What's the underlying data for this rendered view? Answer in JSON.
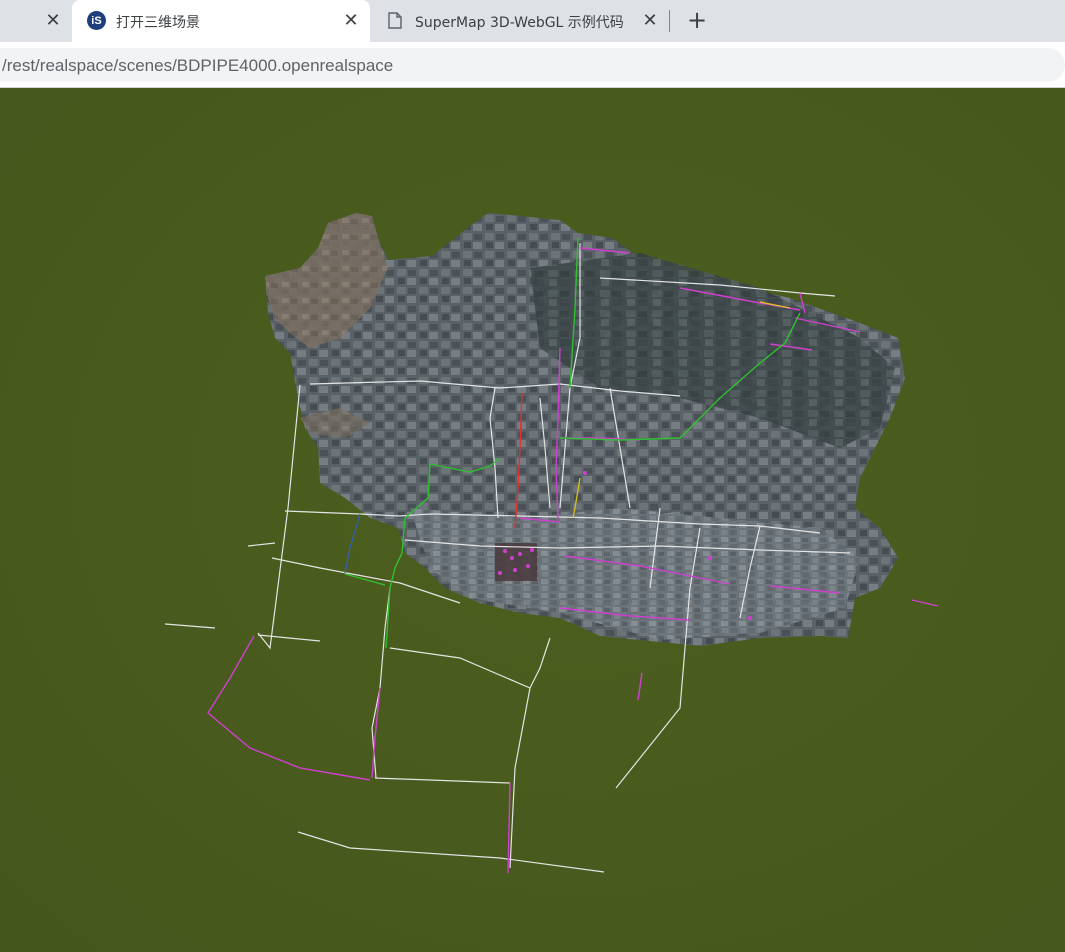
{
  "browser": {
    "tabs": [
      {
        "title": "",
        "close_label": "✕",
        "active": false
      },
      {
        "title": "打开三维场景",
        "favicon": "supermap-is-icon",
        "close_label": "✕",
        "active": true
      },
      {
        "title": "SuperMap 3D-WebGL 示例代码",
        "favicon": "document-icon",
        "close_label": "✕",
        "active": false
      }
    ],
    "new_tab_label": "+",
    "url": "/rest/realspace/scenes/BDPIPE4000.openrealspace"
  },
  "scene": {
    "background_color": "#485a1d",
    "imagery_color": "#5b6369",
    "pipe_colors": {
      "white": "#e8e8e8",
      "magenta": "#d040d0",
      "green": "#30c030",
      "red": "#e03030",
      "yellow": "#e0c020",
      "blue": "#3050c0"
    }
  }
}
